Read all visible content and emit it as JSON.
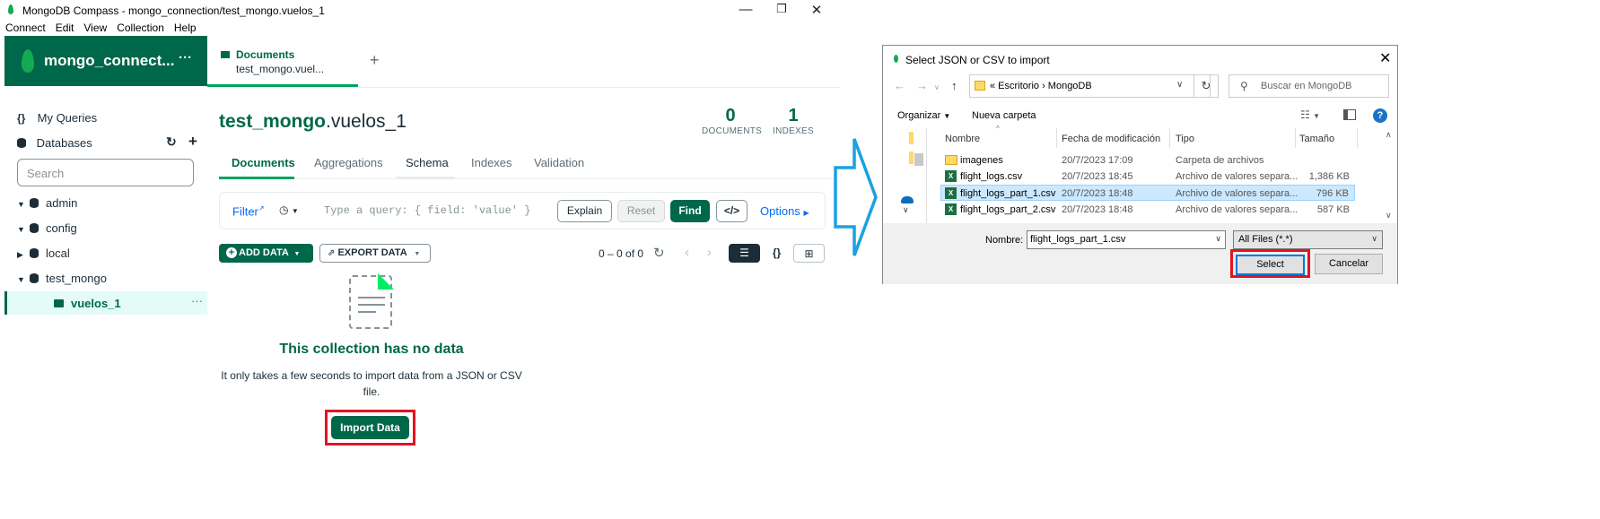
{
  "window": {
    "title": "MongoDB Compass - mongo_connection/test_mongo.vuelos_1",
    "menu": [
      "Connect",
      "Edit",
      "View",
      "Collection",
      "Help"
    ]
  },
  "sidebar": {
    "connection_name": "mongo_connect...",
    "more": "···",
    "my_queries": "My Queries",
    "databases": "Databases",
    "search_placeholder": "Search",
    "tree": [
      {
        "name": "admin"
      },
      {
        "name": "config"
      },
      {
        "name": "local"
      },
      {
        "name": "test_mongo"
      }
    ],
    "selected_collection": "vuelos_1"
  },
  "tab": {
    "title": "Documents",
    "subtitle": "test_mongo.vuel..."
  },
  "collection": {
    "db": "test_mongo",
    "name": ".vuelos_1",
    "documents_count": "0",
    "documents_label": "DOCUMENTS",
    "indexes_count": "1",
    "indexes_label": "INDEXES"
  },
  "subtabs": [
    "Documents",
    "Aggregations",
    "Schema",
    "Indexes",
    "Validation"
  ],
  "querybar": {
    "filter": "Filter",
    "placeholder": "Type a query: { field: 'value' }",
    "explain": "Explain",
    "reset": "Reset",
    "find": "Find",
    "code": "</>",
    "options": "Options"
  },
  "toolbar": {
    "add_data": "ADD DATA",
    "export_data": "EXPORT DATA",
    "pagination": "0 – 0 of 0"
  },
  "empty_state": {
    "title": "This collection has no data",
    "description": "It only takes a few seconds to import data from a JSON or CSV file.",
    "import_button": "Import Data"
  },
  "dialog": {
    "title": "Select JSON or CSV to import",
    "path": "«  Escritorio  ›  MongoDB",
    "search_placeholder": "Buscar en MongoDB",
    "organize": "Organizar",
    "new_folder": "Nueva carpeta",
    "columns": [
      "Nombre",
      "Fecha de modificación",
      "Tipo",
      "Tamaño"
    ],
    "files": [
      {
        "name": "imagenes",
        "date": "20/7/2023 17:09",
        "type": "Carpeta de archivos",
        "size": "",
        "kind": "folder"
      },
      {
        "name": "flight_logs.csv",
        "date": "20/7/2023 18:45",
        "type": "Archivo de valores separa...",
        "size": "1,386 KB",
        "kind": "excel"
      },
      {
        "name": "flight_logs_part_1.csv",
        "date": "20/7/2023 18:48",
        "type": "Archivo de valores separa...",
        "size": "796 KB",
        "kind": "excel",
        "selected": true
      },
      {
        "name": "flight_logs_part_2.csv",
        "date": "20/7/2023 18:48",
        "type": "Archivo de valores separa...",
        "size": "587 KB",
        "kind": "excel"
      }
    ],
    "name_label": "Nombre:",
    "name_value": "flight_logs_part_1.csv",
    "filter_value": "All Files (*.*)",
    "select_button": "Select",
    "cancel_button": "Cancelar"
  },
  "colors": {
    "brand_green": "#00684a",
    "accent_green": "#00a35c",
    "highlight_red": "#e4131f",
    "arrow_blue": "#1ba1e2"
  }
}
